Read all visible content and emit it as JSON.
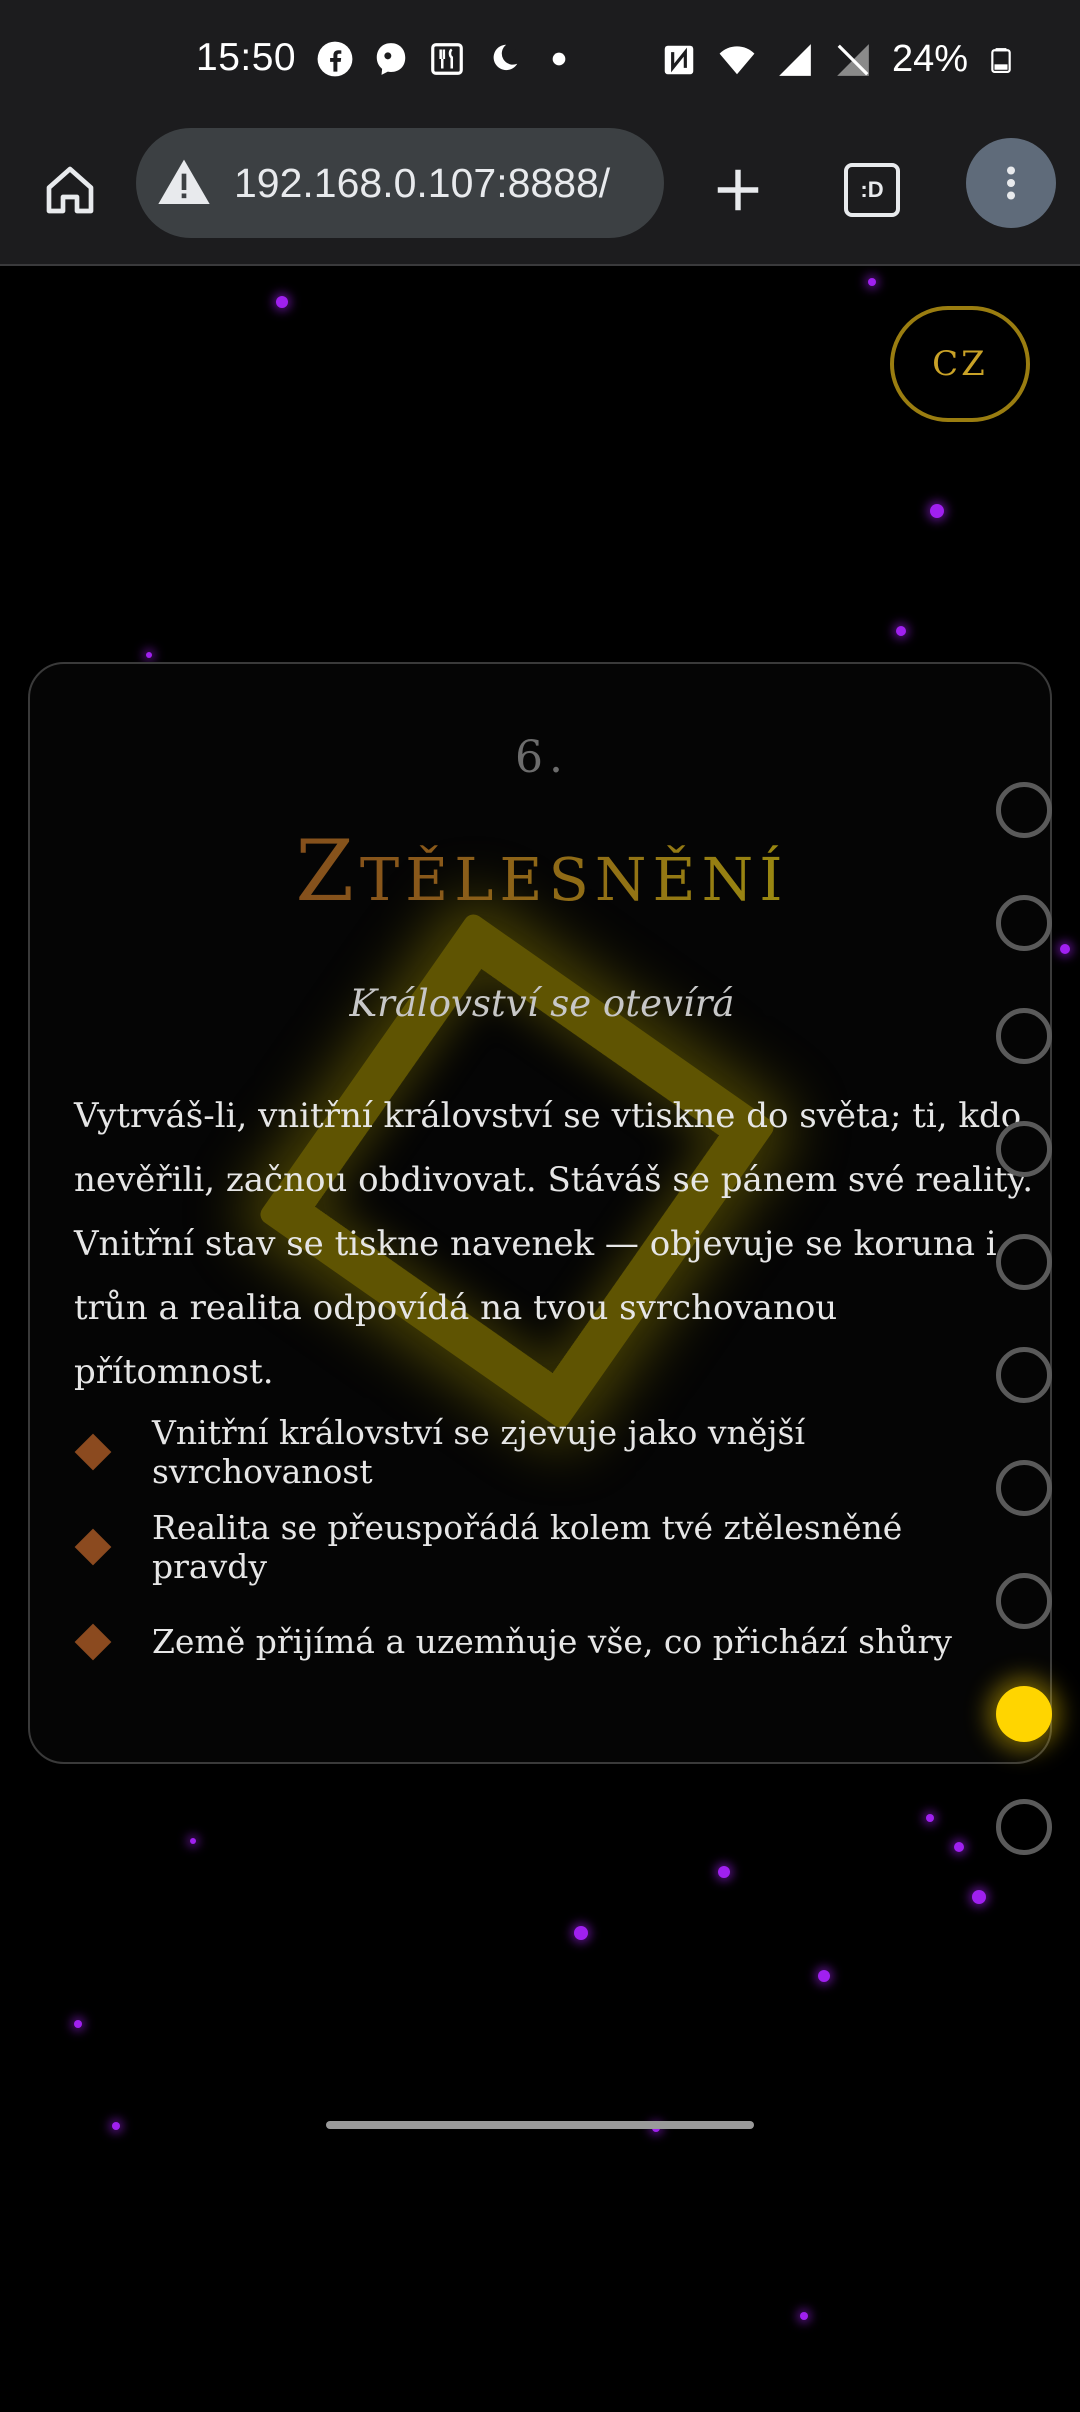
{
  "status_bar": {
    "time": "15:50",
    "battery": "24%",
    "left_icons": [
      "facebook-icon",
      "threads-icon",
      "restaurant-icon",
      "sleep-icon",
      "dot-icon"
    ],
    "right_icons": [
      "nfc-icon",
      "wifi-icon",
      "signal-icon",
      "no-signal-icon",
      "battery-icon"
    ]
  },
  "browser": {
    "url": "192.168.0.107:8888/",
    "tabs_label": ":D"
  },
  "page": {
    "lang_label": "CZ",
    "card": {
      "number": "6.",
      "title": "Ztělesnění",
      "subtitle": "Království se otevírá",
      "body": "Vytrváš-li, vnitřní království se vtiskne do světa; ti, kdo nevěřili, začnou obdivovat. Stáváš se pánem své reality. Vnitřní stav se tiskne navenek — objevuje se koruna i trůn a realita odpovídá na tvou svrchovanou přítomnost.",
      "items": [
        "Vnitřní království se zjevuje jako vnější svrchovanost",
        "Realita se přeuspořádá kolem tvé ztělesněné pravdy",
        "Země přijímá a uzemňuje vše, co přichází shůry"
      ]
    },
    "nav": {
      "total": 10,
      "active_index": 8
    },
    "colors": {
      "accent_gold": "#ffd500",
      "title_gradient_start": "#7a3d1f",
      "title_gradient_end": "#a89a10",
      "particle": "#a020f0",
      "bullet": "#8b4a1f"
    }
  }
}
